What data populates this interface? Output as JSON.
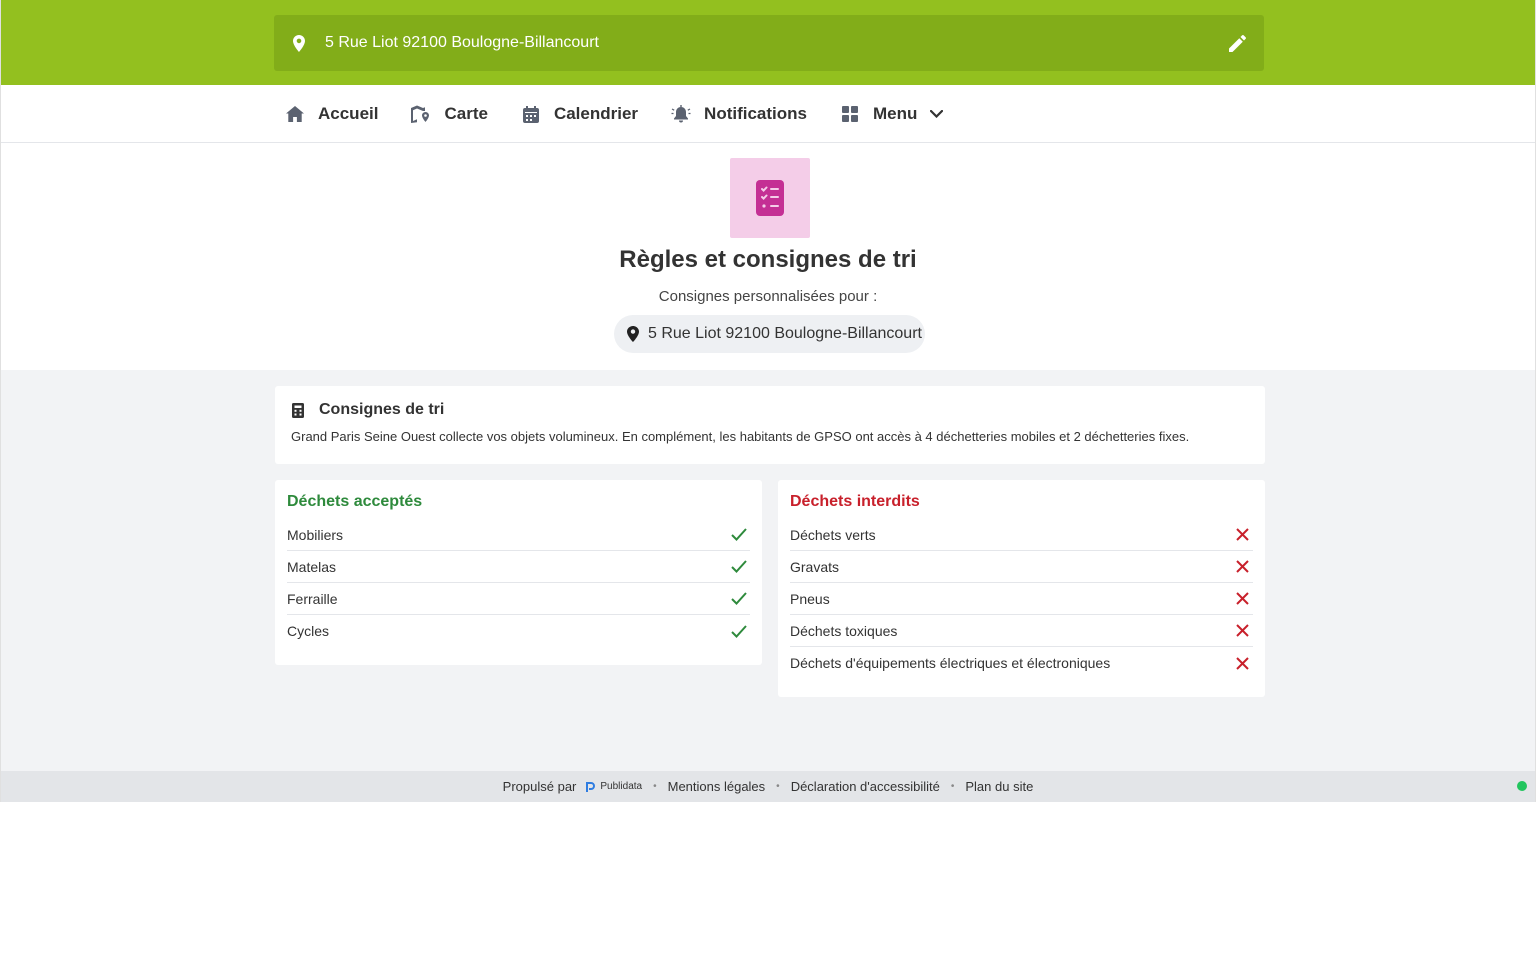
{
  "topbar": {
    "address": "5 Rue Liot 92100 Boulogne-Billancourt",
    "pin_icon": "location-pin-icon",
    "edit_icon": "pencil-icon"
  },
  "nav": {
    "items": [
      {
        "label": "Accueil",
        "icon": "home-icon"
      },
      {
        "label": "Carte",
        "icon": "map-pin-icon"
      },
      {
        "label": "Calendrier",
        "icon": "calendar-icon"
      },
      {
        "label": "Notifications",
        "icon": "bell-icon"
      },
      {
        "label": "Menu",
        "icon": "grid-icon"
      }
    ]
  },
  "hero": {
    "icon": "checklist-icon",
    "title": "Règles et consignes de tri",
    "subtitle": "Consignes personnalisées pour :",
    "address": "5 Rue Liot 92100 Boulogne-Billancourt"
  },
  "info": {
    "title": "Consignes de tri",
    "description": "Grand Paris Seine Ouest collecte vos objets volumineux. En complément, les habitants de GPSO ont accès à 4 déchetteries mobiles et 2 déchetteries fixes."
  },
  "accepted": {
    "title": "Déchets acceptés",
    "items": [
      "Mobiliers",
      "Matelas",
      "Ferraille",
      "Cycles"
    ]
  },
  "refused": {
    "title": "Déchets interdits",
    "items": [
      "Déchets verts",
      "Gravats",
      "Pneus",
      "Déchets toxiques",
      "Déchets d'équipements électriques et électroniques"
    ]
  },
  "footer": {
    "powered_by": "Propulsé par",
    "brand": "Publidata",
    "legal": "Mentions légales",
    "accessibility": "Déclaration d'accessibilité",
    "sitemap": "Plan du site"
  },
  "colors": {
    "brand_green": "#93c01f",
    "accepted_green": "#2e8a3c",
    "refused_red": "#c8202b",
    "hero_icon_bg": "#f4cde8",
    "hero_icon_fg": "#c42f94",
    "status_dot": "#22c55e"
  }
}
